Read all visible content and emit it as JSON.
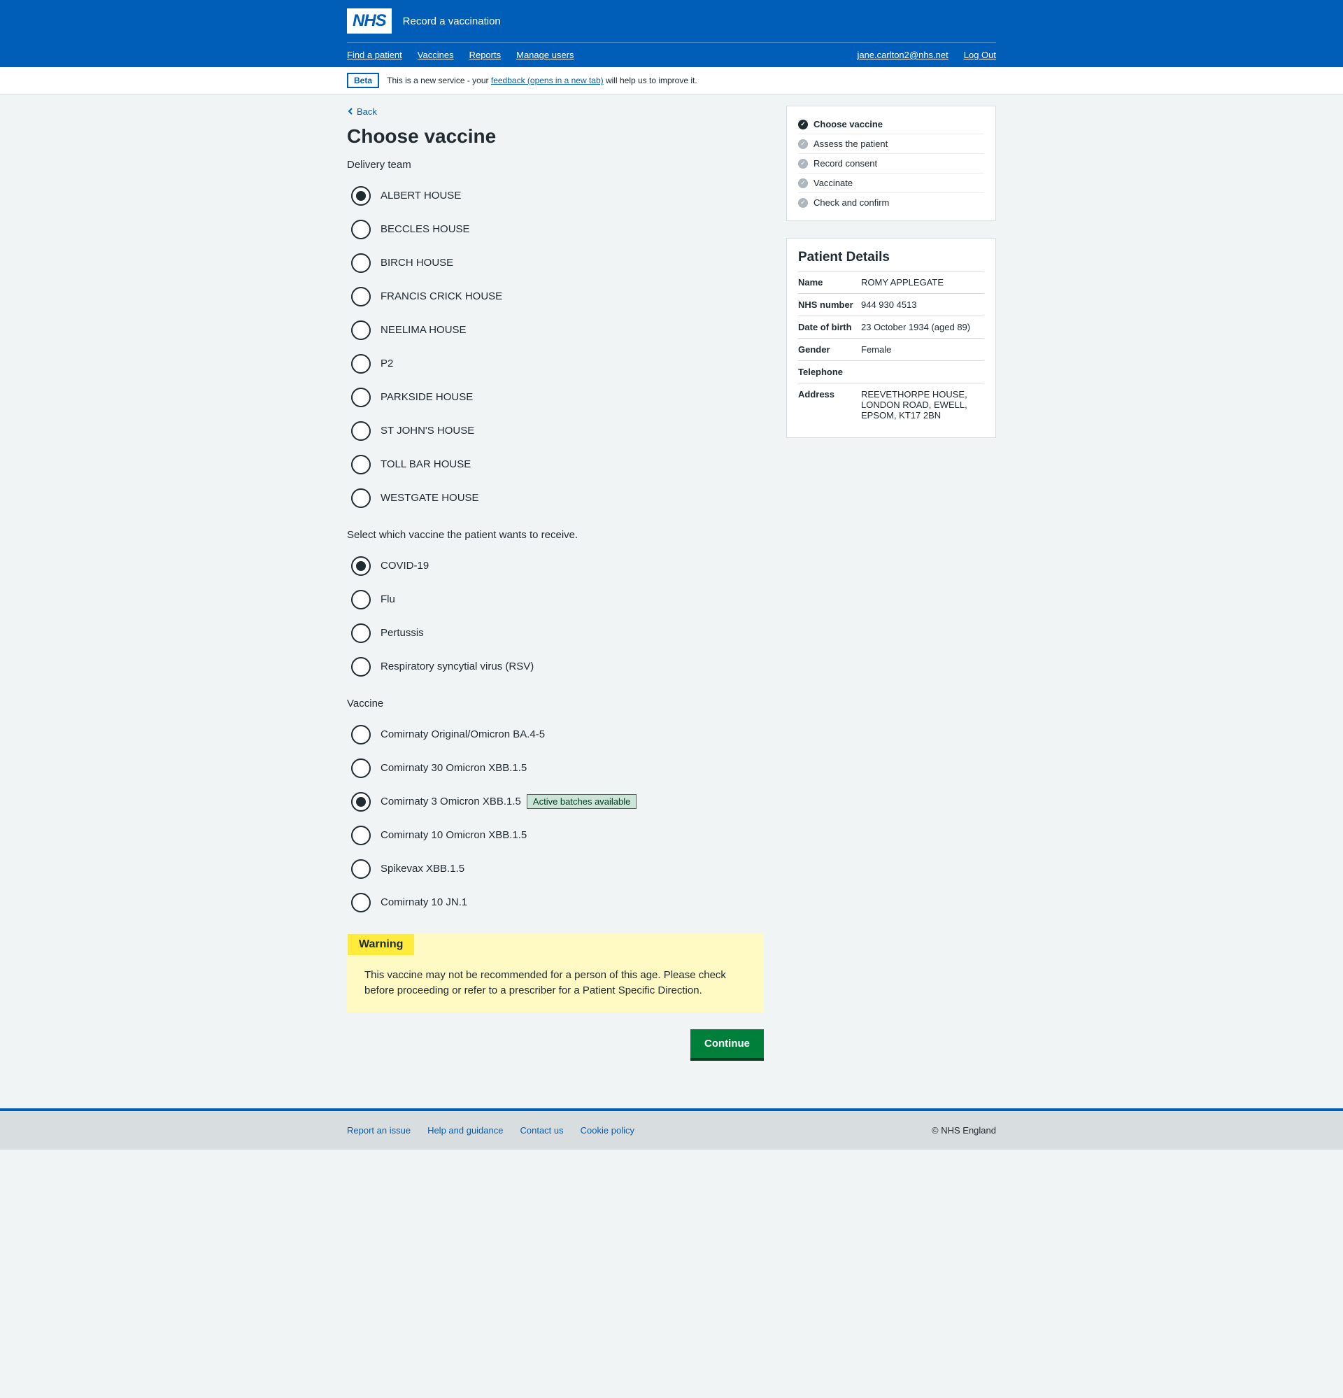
{
  "header": {
    "logo": "NHS",
    "service": "Record a vaccination",
    "nav_left": [
      "Find a patient",
      "Vaccines",
      "Reports",
      "Manage users"
    ],
    "nav_right": [
      "jane.carlton2@nhs.net",
      "Log Out"
    ]
  },
  "phase": {
    "tag": "Beta",
    "text_before": "This is a new service - your ",
    "link": "feedback (opens in a new tab)",
    "text_after": " will help us to improve it."
  },
  "back": "Back",
  "title": "Choose vaccine",
  "delivery_label": "Delivery team",
  "delivery_teams": [
    {
      "label": "ALBERT HOUSE",
      "checked": true
    },
    {
      "label": "BECCLES HOUSE",
      "checked": false
    },
    {
      "label": "BIRCH HOUSE",
      "checked": false
    },
    {
      "label": "FRANCIS CRICK HOUSE",
      "checked": false
    },
    {
      "label": "NEELIMA HOUSE",
      "checked": false
    },
    {
      "label": "P2",
      "checked": false
    },
    {
      "label": "PARKSIDE HOUSE",
      "checked": false
    },
    {
      "label": "ST JOHN'S HOUSE",
      "checked": false
    },
    {
      "label": "TOLL BAR HOUSE",
      "checked": false
    },
    {
      "label": "WESTGATE HOUSE",
      "checked": false
    }
  ],
  "vaccine_type_label": "Select which vaccine the patient wants to receive.",
  "vaccine_types": [
    {
      "label": "COVID-19",
      "checked": true
    },
    {
      "label": "Flu",
      "checked": false
    },
    {
      "label": "Pertussis",
      "checked": false
    },
    {
      "label": "Respiratory syncytial virus (RSV)",
      "checked": false
    }
  ],
  "vaccine_label": "Vaccine",
  "vaccines": [
    {
      "label": "Comirnaty Original/Omicron BA.4-5",
      "checked": false,
      "tag": null
    },
    {
      "label": "Comirnaty 30 Omicron XBB.1.5",
      "checked": false,
      "tag": null
    },
    {
      "label": "Comirnaty 3 Omicron XBB.1.5",
      "checked": true,
      "tag": "Active batches available"
    },
    {
      "label": "Comirnaty 10 Omicron XBB.1.5",
      "checked": false,
      "tag": null
    },
    {
      "label": "Spikevax XBB.1.5",
      "checked": false,
      "tag": null
    },
    {
      "label": "Comirnaty 10 JN.1",
      "checked": false,
      "tag": null
    }
  ],
  "warning": {
    "label": "Warning",
    "text": "This vaccine may not be recommended for a person of this age. Please check before proceeding or refer to a prescriber for a Patient Specific Direction."
  },
  "continue": "Continue",
  "steps": [
    {
      "label": "Choose vaccine",
      "state": "current"
    },
    {
      "label": "Assess the patient",
      "state": "pending"
    },
    {
      "label": "Record consent",
      "state": "pending"
    },
    {
      "label": "Vaccinate",
      "state": "pending"
    },
    {
      "label": "Check and confirm",
      "state": "pending"
    }
  ],
  "patient": {
    "heading": "Patient Details",
    "rows": [
      {
        "k": "Name",
        "v": "ROMY APPLEGATE"
      },
      {
        "k": "NHS number",
        "v": "944 930 4513"
      },
      {
        "k": "Date of birth",
        "v": "23 October 1934 (aged 89)"
      },
      {
        "k": "Gender",
        "v": "Female"
      },
      {
        "k": "Telephone",
        "v": ""
      },
      {
        "k": "Address",
        "v": "REEVETHORPE HOUSE, LONDON ROAD, EWELL, EPSOM, KT17 2BN"
      }
    ]
  },
  "footer": {
    "links": [
      "Report an issue",
      "Help and guidance",
      "Contact us",
      "Cookie policy"
    ],
    "copyright": "© NHS England"
  }
}
